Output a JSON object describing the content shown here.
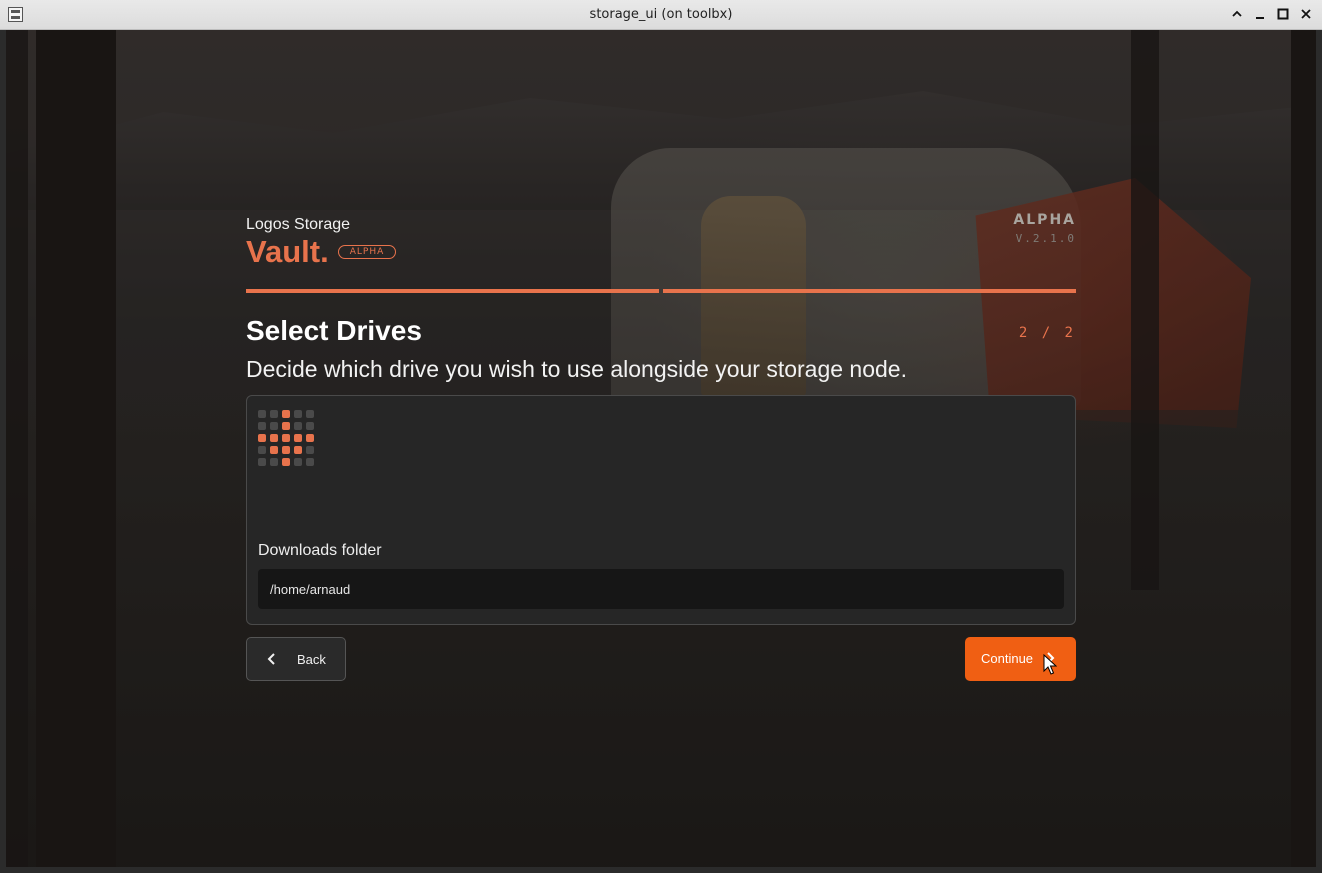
{
  "window": {
    "title": "storage_ui (on toolbx)",
    "icons": [
      "app-icon",
      "maximize-up-icon",
      "minimize-icon",
      "restore-icon",
      "close-icon"
    ]
  },
  "brand": {
    "product_line": "Logos Storage",
    "name": "Vault.",
    "badge": "ALPHA"
  },
  "release": {
    "label": "ALPHA",
    "version": "V.2.1.0"
  },
  "progress": {
    "steps_total": 2,
    "steps_completed": 2
  },
  "step": {
    "title": "Select Drives",
    "counter": "2 / 2",
    "description": "Decide which drive you wish to use alongside your storage node."
  },
  "drive_card": {
    "icon": "pixel-grid-icon",
    "field_label": "Downloads folder",
    "path_value": "/home/arnaud"
  },
  "actions": {
    "back_label": "Back",
    "continue_label": "Continue"
  },
  "colors": {
    "accent": "#e8734c",
    "primary_button": "#f05f13",
    "card_background": "#262626"
  }
}
